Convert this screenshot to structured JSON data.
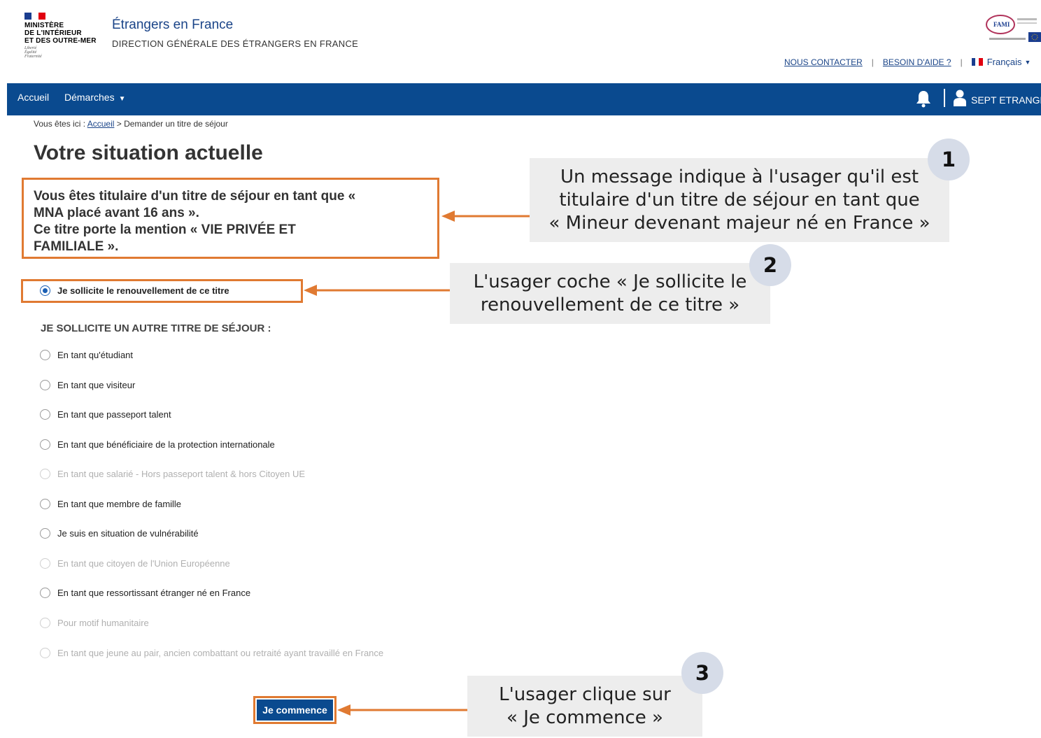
{
  "header": {
    "ministry_lines": [
      "MINISTÈRE",
      "DE L'INTÉRIEUR",
      "ET DES OUTRE-MER"
    ],
    "motto_lines": [
      "Liberté",
      "Égalité",
      "Fraternité"
    ],
    "site_title": "Étrangers en France",
    "site_subtitle": "DIRECTION GÉNÉRALE DES ÉTRANGERS EN FRANCE",
    "fami_logo_text": "FAMI",
    "links": {
      "contact": "NOUS CONTACTER",
      "help": "BESOIN D'AIDE ?",
      "separator": "|",
      "language": "Français"
    }
  },
  "nav": {
    "home": "Accueil",
    "procedures": "Démarches",
    "user_name": "SEPT ETRANGE"
  },
  "breadcrumb": {
    "prefix": "Vous êtes ici :",
    "home": "Accueil",
    "current": "> Demander un titre de séjour"
  },
  "page_title": "Votre situation actuelle",
  "info_lines": [
    "Vous êtes titulaire d'un titre de séjour en tant que «",
    "MNA placé avant 16 ans ».",
    "Ce titre porte la mention « VIE PRIVÉE ET",
    "FAMILIALE »."
  ],
  "renewal_option": {
    "label": "Je sollicite le renouvellement de ce titre",
    "checked": true
  },
  "other_section_label": "JE SOLLICITE UN AUTRE TITRE DE SÉJOUR :",
  "options": [
    {
      "label": "En tant qu'étudiant",
      "disabled": false
    },
    {
      "label": "En tant que visiteur",
      "disabled": false
    },
    {
      "label": "En tant que passeport talent",
      "disabled": false
    },
    {
      "label": "En tant que bénéficiaire de la protection internationale",
      "disabled": false
    },
    {
      "label": "En tant que salarié - Hors passeport talent & hors Citoyen UE",
      "disabled": true
    },
    {
      "label": "En tant que membre de famille",
      "disabled": false
    },
    {
      "label": "Je suis en situation de vulnérabilité",
      "disabled": false
    },
    {
      "label": "En tant que citoyen de l'Union Européenne",
      "disabled": true
    },
    {
      "label": "En tant que ressortissant étranger né en France",
      "disabled": false
    },
    {
      "label": "Pour motif humanitaire",
      "disabled": true
    },
    {
      "label": "En tant que jeune au pair, ancien combattant ou retraité ayant travaillé en France",
      "disabled": true
    }
  ],
  "start_button": "Je commence",
  "annotations": [
    {
      "number": "1",
      "lines": [
        "Un message indique à l'usager qu'il est",
        "titulaire d'un titre de séjour en tant que",
        "« Mineur devenant majeur né en France »"
      ]
    },
    {
      "number": "2",
      "lines": [
        "L'usager coche « Je sollicite le",
        "renouvellement de ce titre »"
      ]
    },
    {
      "number": "3",
      "lines": [
        "L'usager clique sur",
        "« Je commence »"
      ]
    }
  ],
  "colors": {
    "nav_blue": "#0a4a8f",
    "annotation_orange": "#e07a32",
    "callout_bg": "#ededed",
    "badge_bg": "#d6dce8"
  }
}
